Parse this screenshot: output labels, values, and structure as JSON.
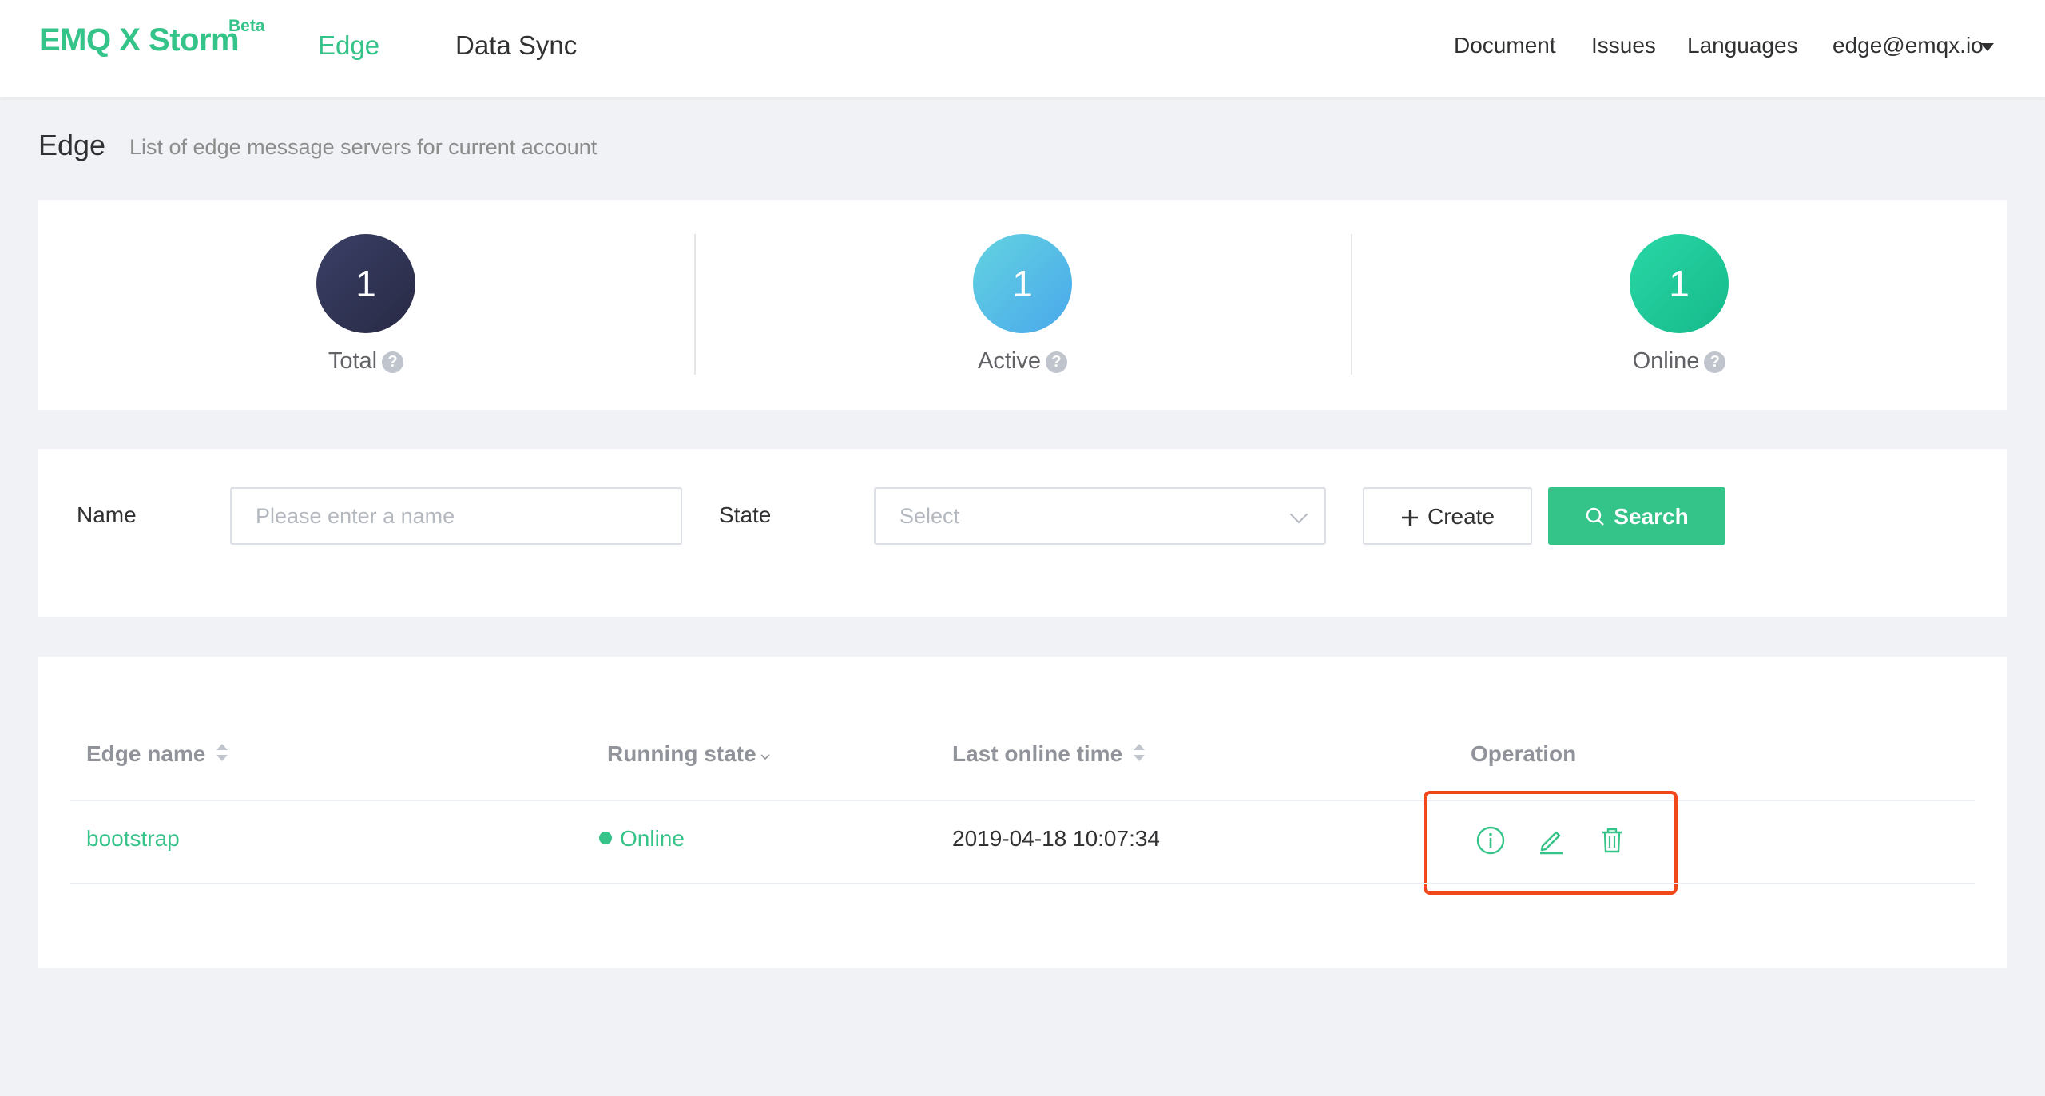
{
  "header": {
    "logo": "EMQ X Storm",
    "logo_badge": "Beta",
    "nav": [
      {
        "label": "Edge",
        "active": true
      },
      {
        "label": "Data Sync",
        "active": false
      }
    ],
    "links": {
      "document": "Document",
      "issues": "Issues",
      "languages": "Languages",
      "user": "edge@emqx.io"
    }
  },
  "page": {
    "title": "Edge",
    "subtitle": "List of edge message servers for current account"
  },
  "stats": [
    {
      "value": "1",
      "label": "Total",
      "color_from": "#3a3f66",
      "color_to": "#282a44"
    },
    {
      "value": "1",
      "label": "Active",
      "color_from": "#63d3e0",
      "color_to": "#4aa8ec"
    },
    {
      "value": "1",
      "label": "Online",
      "color_from": "#2ad7a6",
      "color_to": "#15b98a"
    }
  ],
  "filter": {
    "name_label": "Name",
    "name_placeholder": "Please enter a name",
    "state_label": "State",
    "state_placeholder": "Select",
    "create_label": "Create",
    "search_label": "Search"
  },
  "table": {
    "columns": [
      "Edge name",
      "Running state",
      "Last online time",
      "Operation"
    ],
    "rows": [
      {
        "name": "bootstrap",
        "state": "Online",
        "last_online": "2019-04-18 10:07:34"
      }
    ]
  },
  "colors": {
    "accent": "#34c388",
    "highlight": "#f0481b"
  }
}
